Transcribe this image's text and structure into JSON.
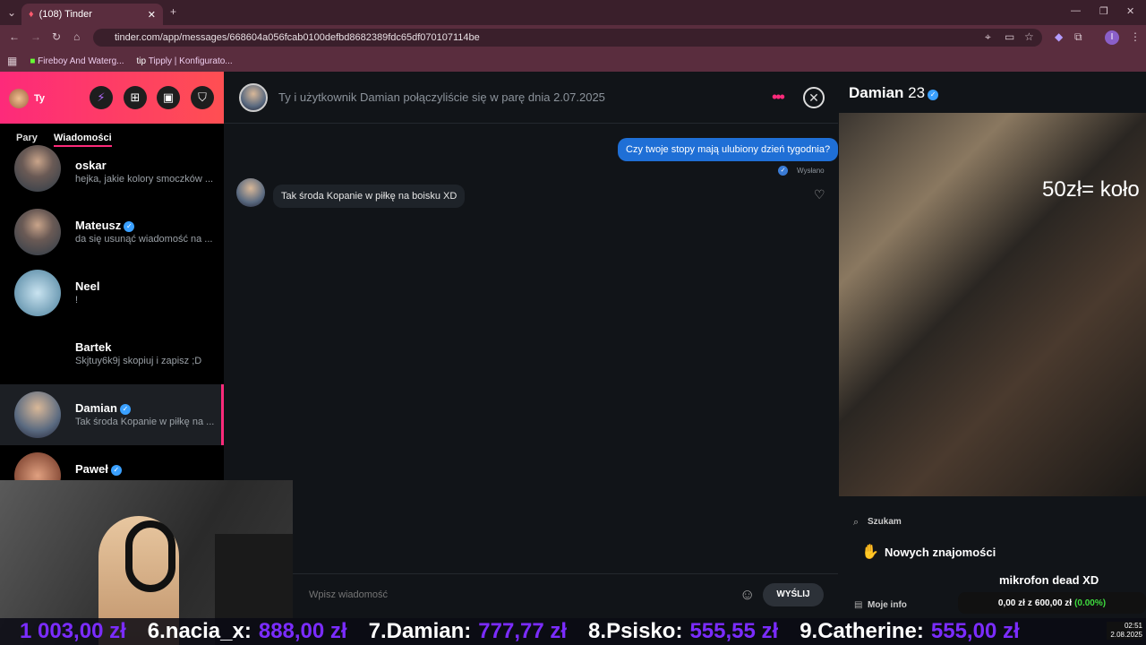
{
  "browser": {
    "tab_title": "(108) Tinder",
    "url": "tinder.com/app/messages/668604a056fcab0100defbd8682389fdc65df070107114be",
    "bookmarks": [
      "Fireboy And Waterg...",
      "Tipply | Konfigurato..."
    ]
  },
  "sidebar": {
    "user_label": "Ty",
    "tabs": [
      "Pary",
      "Wiadomości"
    ],
    "matches": [
      {
        "name": "oskar",
        "verified": false,
        "message": "hejka, jakie kolory smoczków ..."
      },
      {
        "name": "Mateusz",
        "verified": true,
        "message": "da się usunąć wiadomość na ..."
      },
      {
        "name": "Neel",
        "verified": false,
        "message": "!"
      },
      {
        "name": "Bartek",
        "verified": false,
        "message": "Skjtuy6k9j skopiuj i zapisz ;D"
      },
      {
        "name": "Damian",
        "verified": true,
        "message": "Tak środa Kopanie w piłkę na ..."
      },
      {
        "name": "Paweł",
        "verified": true,
        "message": ""
      }
    ]
  },
  "chat": {
    "header": "Ty i użytkownik Damian połączyliście się w parę dnia 2.07.2025",
    "sent_message": "Czy twoje stopy mają ulubiony dzień tygodnia?",
    "sent_status": "Wysłano",
    "received_message": "Tak środa Kopanie w piłkę na boisku XD",
    "input_placeholder": "Wpisz wiadomość",
    "send_label": "WYŚLIJ"
  },
  "profile": {
    "name": "Damian",
    "age": "23",
    "photo_caption": "50zł= koło",
    "looking_for_label": "Szukam",
    "looking_for_value": "Nowych znajomości",
    "my_info_label": "Moje info"
  },
  "stream_overlay": {
    "mic_note": "mikrofon dead XD",
    "goal_current": "0,00 zł",
    "goal_of": "z",
    "goal_target": "600,00 zł",
    "goal_percent": "(0.00%)",
    "ticker": [
      {
        "label": "",
        "amount": "1 003,00 zł"
      },
      {
        "label": "6.nacia_x:",
        "amount": "888,00 zł"
      },
      {
        "label": "7.Damian:",
        "amount": "777,77 zł"
      },
      {
        "label": "8.Psisko:",
        "amount": "555,55 zł"
      },
      {
        "label": "9.Catherine:",
        "amount": "555,00 zł"
      }
    ],
    "clock_time": "02:51",
    "clock_date": "2.08.2025"
  },
  "colors": {
    "accent": "#fd2a7a",
    "sent_bubble": "#1f6fd6",
    "ticker_amount": "#7b2cff"
  }
}
